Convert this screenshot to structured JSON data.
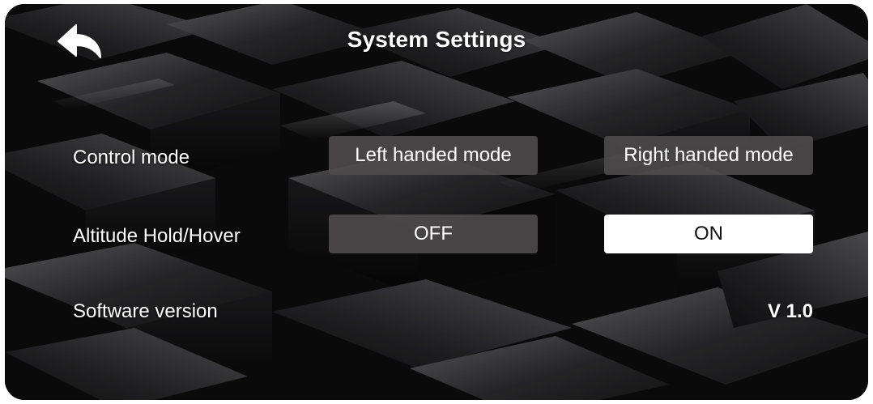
{
  "header": {
    "title": "System Settings",
    "back_icon": "back-arrow-icon"
  },
  "settings": {
    "control_mode": {
      "label": "Control mode",
      "options": [
        "Left handed mode",
        "Right handed mode"
      ]
    },
    "altitude_hold": {
      "label": "Altitude Hold/Hover",
      "options": [
        "OFF",
        "ON"
      ],
      "selected": "ON"
    },
    "software_version": {
      "label": "Software version",
      "value": "V 1.0"
    }
  },
  "colors": {
    "background": "#0b0b0c",
    "button_dark": "#4e4c4c",
    "button_selected": "#ffffff",
    "text": "#ffffff"
  }
}
